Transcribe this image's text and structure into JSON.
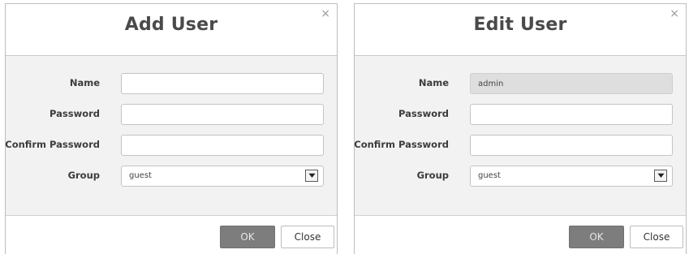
{
  "add_dialog": {
    "title": "Add User",
    "close_glyph": "×",
    "fields": {
      "name": {
        "label": "Name",
        "value": ""
      },
      "password": {
        "label": "Password",
        "value": ""
      },
      "confirm_password": {
        "label": "Confirm Password",
        "value": ""
      },
      "group": {
        "label": "Group",
        "selected": "guest"
      }
    },
    "buttons": {
      "ok": "OK",
      "close": "Close"
    }
  },
  "edit_dialog": {
    "title": "Edit User",
    "close_glyph": "×",
    "fields": {
      "name": {
        "label": "Name",
        "value": "admin",
        "readonly": true
      },
      "password": {
        "label": "Password",
        "value": ""
      },
      "confirm_password": {
        "label": "Confirm Password",
        "value": ""
      },
      "group": {
        "label": "Group",
        "selected": "guest"
      }
    },
    "buttons": {
      "ok": "OK",
      "close": "Close"
    }
  },
  "icons": {
    "dropdown": "chevron-down-icon",
    "close": "close-icon"
  },
  "colors": {
    "ok_button": "#7d7d7d",
    "body_background": "#f2f2f2",
    "title_text": "#4a4a4a"
  }
}
